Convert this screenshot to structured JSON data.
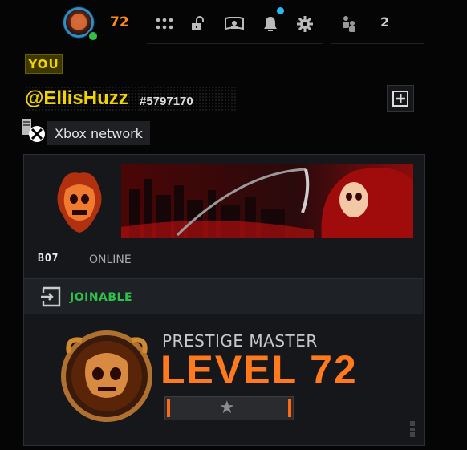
{
  "header": {
    "player_level": "72",
    "party_count": "2",
    "nav_icons": [
      "grid-icon",
      "unlock-icon",
      "theater-icon",
      "bell-icon",
      "gear-icon"
    ],
    "party_icon": "party-members-icon"
  },
  "profile": {
    "you_label": "YOU",
    "gamertag": "@EllisHuzz",
    "tag_number": "#5797170",
    "platform_label": "Xbox network"
  },
  "card": {
    "clan_tag": "BO7",
    "status": "ONLINE",
    "joinable_label": "JOINABLE",
    "prestige_title": "PRESTIGE MASTER",
    "level_label": "LEVEL 72"
  },
  "colors": {
    "accent_yellow": "#f1d400",
    "accent_orange": "#ff7a1c",
    "online_green": "#2ec24a",
    "notification_blue": "#27b9f0"
  }
}
